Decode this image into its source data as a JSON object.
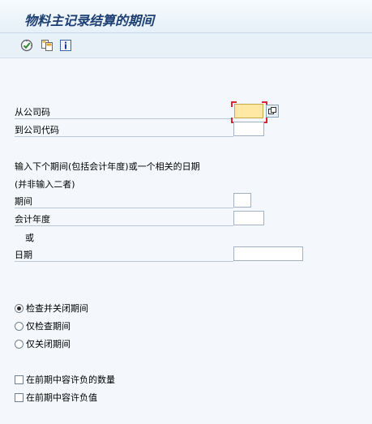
{
  "title": "物料主记录结算的期间",
  "toolbar": {
    "icons": [
      "execute-icon",
      "variant-icon",
      "info-icon"
    ]
  },
  "fields": {
    "from_company_code": {
      "label": "从公司码",
      "value": ""
    },
    "to_company_code": {
      "label": "到公司代码",
      "value": ""
    }
  },
  "instructions": {
    "line1": "输入下个期间(包括会计年度)或一个相关的日期",
    "line2": "(并非输入二者)"
  },
  "period": {
    "label": "期间",
    "value": ""
  },
  "fiscal_year": {
    "label": "会计年度",
    "value": ""
  },
  "or_text": "或",
  "date": {
    "label": "日期",
    "value": ""
  },
  "options": [
    {
      "label": "检查并关闭期间",
      "selected": true
    },
    {
      "label": "仅检查期间",
      "selected": false
    },
    {
      "label": "仅关闭期间",
      "selected": false
    }
  ],
  "checkboxes": [
    {
      "label": "在前期中容许负的数量",
      "checked": false
    },
    {
      "label": "在前期中容许负值",
      "checked": false
    }
  ]
}
